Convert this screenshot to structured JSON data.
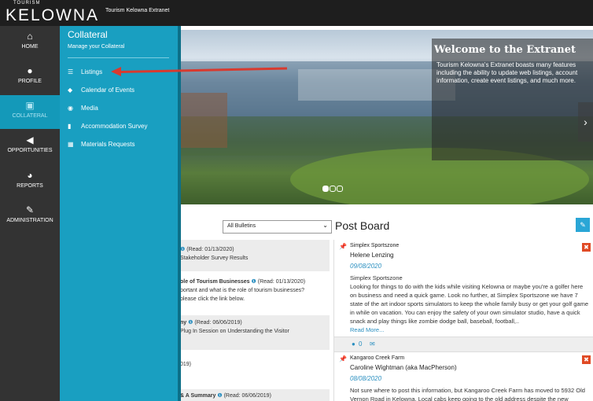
{
  "brand": {
    "logo_small": "TOURISM",
    "logo_big": "KELOWNA",
    "app_title": "Tourism Kelowna Extranet"
  },
  "colors": {
    "accent": "#199fc1",
    "active_nav": "#1499b9",
    "danger": "#e04a25",
    "sidebar": "#333333"
  },
  "nav": [
    {
      "icon": "home-icon",
      "glyph": "⌂",
      "label": "HOME"
    },
    {
      "icon": "user-icon",
      "glyph": "●",
      "label": "PROFILE"
    },
    {
      "icon": "file-image-icon",
      "glyph": "▣",
      "label": "COLLATERAL"
    },
    {
      "icon": "bullhorn-icon",
      "glyph": "◀",
      "label": "OPPORTUNITIES"
    },
    {
      "icon": "pie-chart-icon",
      "glyph": "◕",
      "label": "REPORTS"
    },
    {
      "icon": "wrench-icon",
      "glyph": "✎",
      "label": "ADMINISTRATION"
    }
  ],
  "flyout": {
    "title": "Collateral",
    "subtitle": "Manage your Collateral",
    "items": [
      {
        "icon": "list-icon",
        "glyph": "☰",
        "label": "Listings"
      },
      {
        "icon": "tag-icon",
        "glyph": "◆",
        "label": "Calendar of Events"
      },
      {
        "icon": "camera-icon",
        "glyph": "◉",
        "label": "Media"
      },
      {
        "icon": "document-icon",
        "glyph": "▮",
        "label": "Accommodation Survey"
      },
      {
        "icon": "table-icon",
        "glyph": "▦",
        "label": "Materials Requests"
      }
    ]
  },
  "hero": {
    "heading": "Welcome to the Extranet",
    "text": "Tourism Kelowna's Extranet boasts many features including the ability to update web listings, account information, create event listings, and much more.",
    "next_glyph": "›"
  },
  "bulletins": {
    "filter_value": "All Bulletins",
    "items": [
      {
        "line1_tail": "(Read: 01/13/2020)",
        "line2": "Stakeholder Survey Results"
      },
      {
        "title": "ole of Tourism Businesses",
        "read": "(Read: 01/13/2020)",
        "line2": "portant and what is the role of tourism businesses?",
        "line3": "please click the link below."
      },
      {
        "title": "ny",
        "read": "(Read: 06/06/2019)",
        "line2": "Plug In Session on Understanding the Visitor"
      },
      {
        "line1": "019)"
      },
      {
        "title": "& A Summary",
        "read": "(Read: 06/06/2019)"
      }
    ]
  },
  "post_board": {
    "title": "Post Board",
    "posts": [
      {
        "name": "Simplex Sportszone",
        "author": "Helene Lenzing",
        "date": "09/08/2020",
        "body_title": "Simplex Sportszone",
        "body": "Looking for things to do with the kids while visiting Kelowna or maybe you're a golfer here on business and need a quick game. Look no further, at Simplex Sportszone we have 7 state of the art indoor sports simulators to keep the whole family busy or get your golf game in while on vacation. You can enjoy the safety of your own simulator studio, have a quick snack and play things like zombie dodge ball, baseball, football,..",
        "more": "Read More...",
        "comments": "0"
      },
      {
        "name": "Kangaroo Creek Farm",
        "author": "Caroline Wightman (aka MacPherson)",
        "date": "08/08/2020",
        "body": "Not sure where to post this information, but Kangaroo Creek Farm has moved to 5932 Old Vernon Road in Kelowna. Local cabs keep going to the old address despite the new"
      }
    ]
  }
}
